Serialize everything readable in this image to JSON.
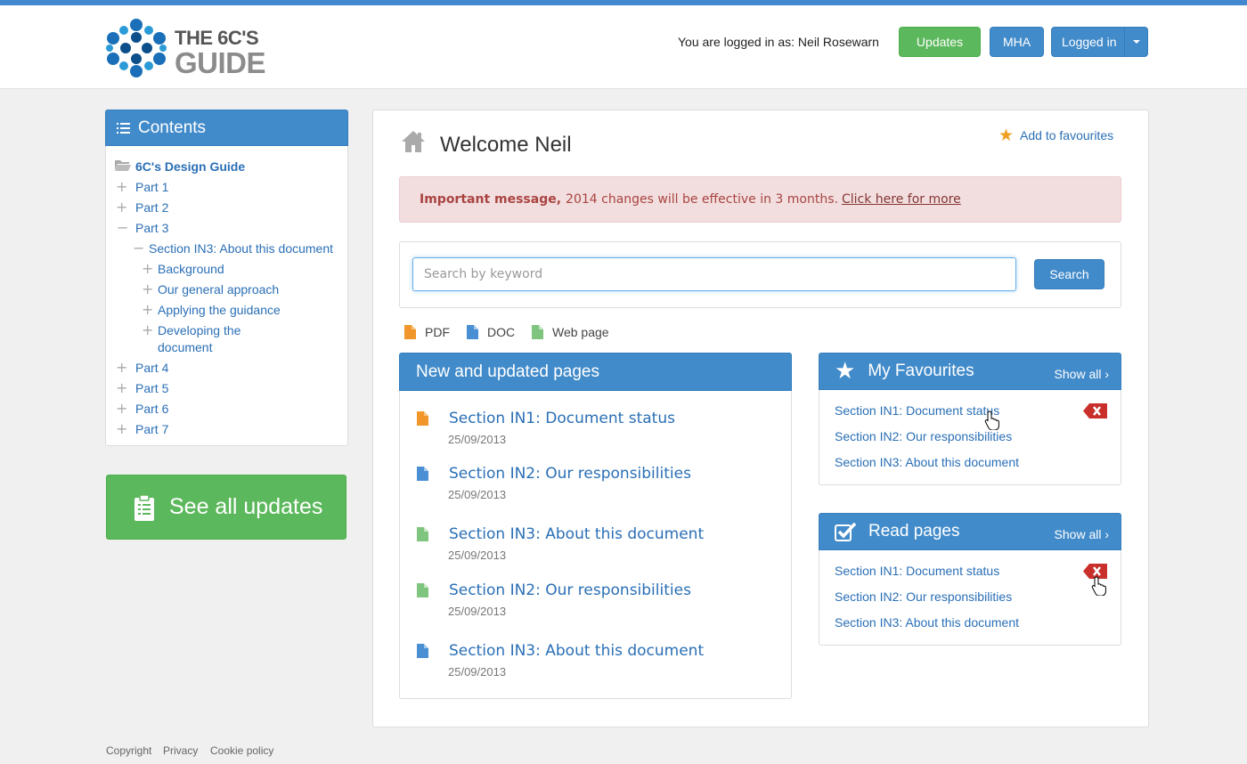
{
  "header": {
    "logo": {
      "line1": "THE 6C'S",
      "line2": "GUIDE"
    },
    "logged_in_text": "You are logged in as: Neil Rosewarn",
    "buttons": {
      "updates": "Updates",
      "mha": "MHA",
      "logged_in": "Logged in"
    },
    "colors": {
      "topbar": "#4288ce",
      "primary": "#428bca",
      "success": "#5cb85c"
    }
  },
  "sidebar": {
    "title": "Contents",
    "tree": [
      {
        "label": "6C's Design Guide",
        "expander": "folder"
      },
      {
        "label": "Part 1",
        "expander": "+"
      },
      {
        "label": "Part 2",
        "expander": "+"
      },
      {
        "label": "Part 3",
        "expander": "−"
      },
      {
        "label": "Section IN3: About this document",
        "expander": "−"
      },
      {
        "label": "Background",
        "expander": "+"
      },
      {
        "label": "Our general approach",
        "expander": "+"
      },
      {
        "label": "Applying the guidance",
        "expander": "+"
      },
      {
        "label": "Developing the",
        "label2": "document",
        "expander": "+"
      },
      {
        "label": "Part 4",
        "expander": "+"
      },
      {
        "label": "Part 5",
        "expander": "+"
      },
      {
        "label": "Part 6",
        "expander": "+"
      },
      {
        "label": "Part 7",
        "expander": "+"
      }
    ],
    "see_all_updates": "See all updates"
  },
  "main": {
    "welcome": "Welcome Neil",
    "add_to_favourites": "Add to favourites",
    "alert": {
      "bold": "Important message,",
      "text": "2014 changes will be effective in 3 months.",
      "link": "Click here for more"
    },
    "search": {
      "placeholder": "Search by keyword",
      "button": "Search"
    },
    "legend": [
      {
        "label": "PDF",
        "color": "#f0962a"
      },
      {
        "label": "DOC",
        "color": "#4a8fd4"
      },
      {
        "label": "Web page",
        "color": "#7fc57f"
      }
    ],
    "new_updated": {
      "title": "New and updated pages",
      "items": [
        {
          "title": "Section IN1: Document status",
          "date": "25/09/2013",
          "type": "pdf"
        },
        {
          "title": "Section IN2: Our responsibilities",
          "date": "25/09/2013",
          "type": "doc"
        },
        {
          "title": "Section IN3: About this document",
          "date": "25/09/2013",
          "type": "web"
        },
        {
          "title": "Section IN2: Our responsibilities",
          "date": "25/09/2013",
          "type": "web"
        },
        {
          "title": "Section IN3: About this document",
          "date": "25/09/2013",
          "type": "doc"
        }
      ]
    },
    "favourites": {
      "title": "My Favourites",
      "show_all": "Show all ›",
      "items": [
        "Section IN1: Document status",
        "Section IN2: Our responsibilities",
        "Section IN3: About this document"
      ]
    },
    "read_pages": {
      "title": "Read pages",
      "show_all": "Show all ›",
      "items": [
        "Section IN1: Document status",
        "Section IN2: Our responsibilities",
        "Section IN3: About this document"
      ]
    }
  },
  "footer": {
    "links": [
      "Copyright",
      "Privacy",
      "Cookie policy"
    ]
  }
}
